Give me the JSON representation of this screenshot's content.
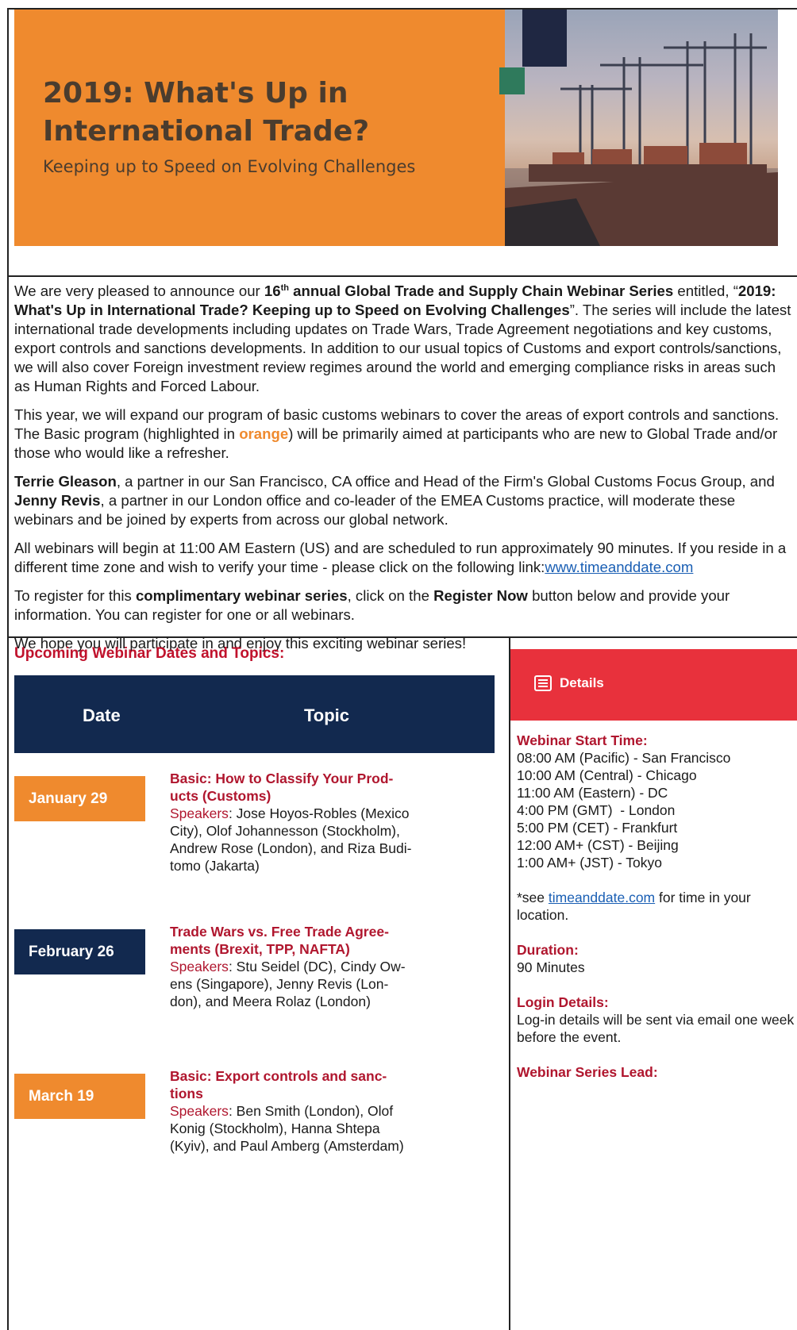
{
  "banner": {
    "title_line1": "2019: What's Up in",
    "title_line2": "International Trade?",
    "subtitle": "Keeping up to Speed on Evolving Challenges"
  },
  "intro": {
    "p1_a": "We are very pleased to announce our ",
    "p1_b": "16",
    "p1_sup": "th",
    "p1_c": " annual Global Trade and Supply Chain Webinar Series",
    "p1_d": " entitled, “",
    "p1_e": "2019: What's Up in International Trade? Keeping up to Speed on Evolving Challenges",
    "p1_f": "”. The series will include the latest international trade developments including updates on Trade Wars, Trade Agreement negotiations and key customs, export controls and sanctions developments. In addition to our usual topics of Customs and export controls/sanctions, we will also cover Foreign investment review regimes around the world and emerging compliance risks in areas such as Human Rights and Forced Labour.",
    "p2_a": "This year, we will expand our program of basic customs webinars to cover the areas of export controls and sanctions. The Basic program (highlighted in ",
    "p2_orange": "orange",
    "p2_b": ") will be primarily aimed at participants who are new to Global Trade and/or those who would like a refresher.",
    "p3_name1": "Terrie Gleason",
    "p3_a": ", a partner in our San Francisco, CA office and Head of the Firm's Global Customs Focus Group, and ",
    "p3_name2": "Jenny Revis",
    "p3_b": ", a partner in our London office and co-leader of the EMEA Customs practice, will moderate these webinars and be joined by experts from across our global network.",
    "p4_a": "All webinars will begin at 11:00 AM Eastern (US) and are scheduled to run approximately 90 minutes. If you reside in a different time zone and wish to verify your time - please click on the following link:",
    "p4_link": "www.timeanddate.com",
    "p5_a": "To register for this ",
    "p5_b": "complimentary webinar series",
    "p5_c": ", click on the ",
    "p5_d": "Register Now",
    "p5_e": " button below and provide your information. You can register for one or all webinars.",
    "p6": " We hope you will participate in and enjoy this exciting webinar series!"
  },
  "schedule": {
    "heading": "Upcoming Webinar Dates and Topics:",
    "col_date": "Date",
    "col_topic": "Topic",
    "speakers_label": "Speakers",
    "rows": [
      {
        "date": "January 29",
        "title_l1": "Basic: How to Classify Your Prod-",
        "title_l2": "ucts (Customs)",
        "sp_l1": ": Jose Hoyos-Robles (Mexico",
        "sp_l2": "City), Olof Johannesson (Stockholm),",
        "sp_l3": "Andrew Rose (London), and Riza Budi-",
        "sp_l4": "tomo (Jakarta)"
      },
      {
        "date": "February 26",
        "title_l1": "Trade Wars vs. Free Trade Agree-",
        "title_l2": "ments (Brexit, TPP, NAFTA)",
        "sp_l1": ": Stu Seidel (DC), Cindy Ow-",
        "sp_l2": "ens (Singapore), Jenny Revis (Lon-",
        "sp_l3": "don), and Meera Rolaz (London)"
      },
      {
        "date": "March 19",
        "title_l1": "Basic: Export controls and sanc-",
        "title_l2": "tions",
        "sp_l1": ": Ben Smith (London), Olof",
        "sp_l2": "Konig (Stockholm), Hanna Shtepa",
        "sp_l3": "(Kyiv), and Paul Amberg (Amsterdam)"
      }
    ]
  },
  "details": {
    "label": "Details",
    "start_heading": "Webinar Start Time:",
    "times": [
      "08:00 AM (Pacific) - San Francisco",
      "10:00 AM (Central) - Chicago",
      "11:00 AM (Eastern) - DC",
      "4:00 PM (GMT)  - London",
      "5:00 PM (CET) - Frankfurt",
      "12:00 AM+ (CST) - Beijing",
      "1:00 AM+ (JST) - Tokyo"
    ],
    "see_a": "*see ",
    "see_link": "timeanddate.com",
    "see_b": " for time in your location.",
    "duration_heading": "Duration:",
    "duration": "90 Minutes",
    "login_heading": "Login Details:",
    "login": "Log-in details will be sent via email one week before the event.",
    "lead_heading": "Webinar Series Lead:"
  },
  "colors": {
    "orange": "#ef8a2e",
    "navy": "#12294f",
    "red": "#e8313c",
    "dark_red": "#b0162e"
  }
}
